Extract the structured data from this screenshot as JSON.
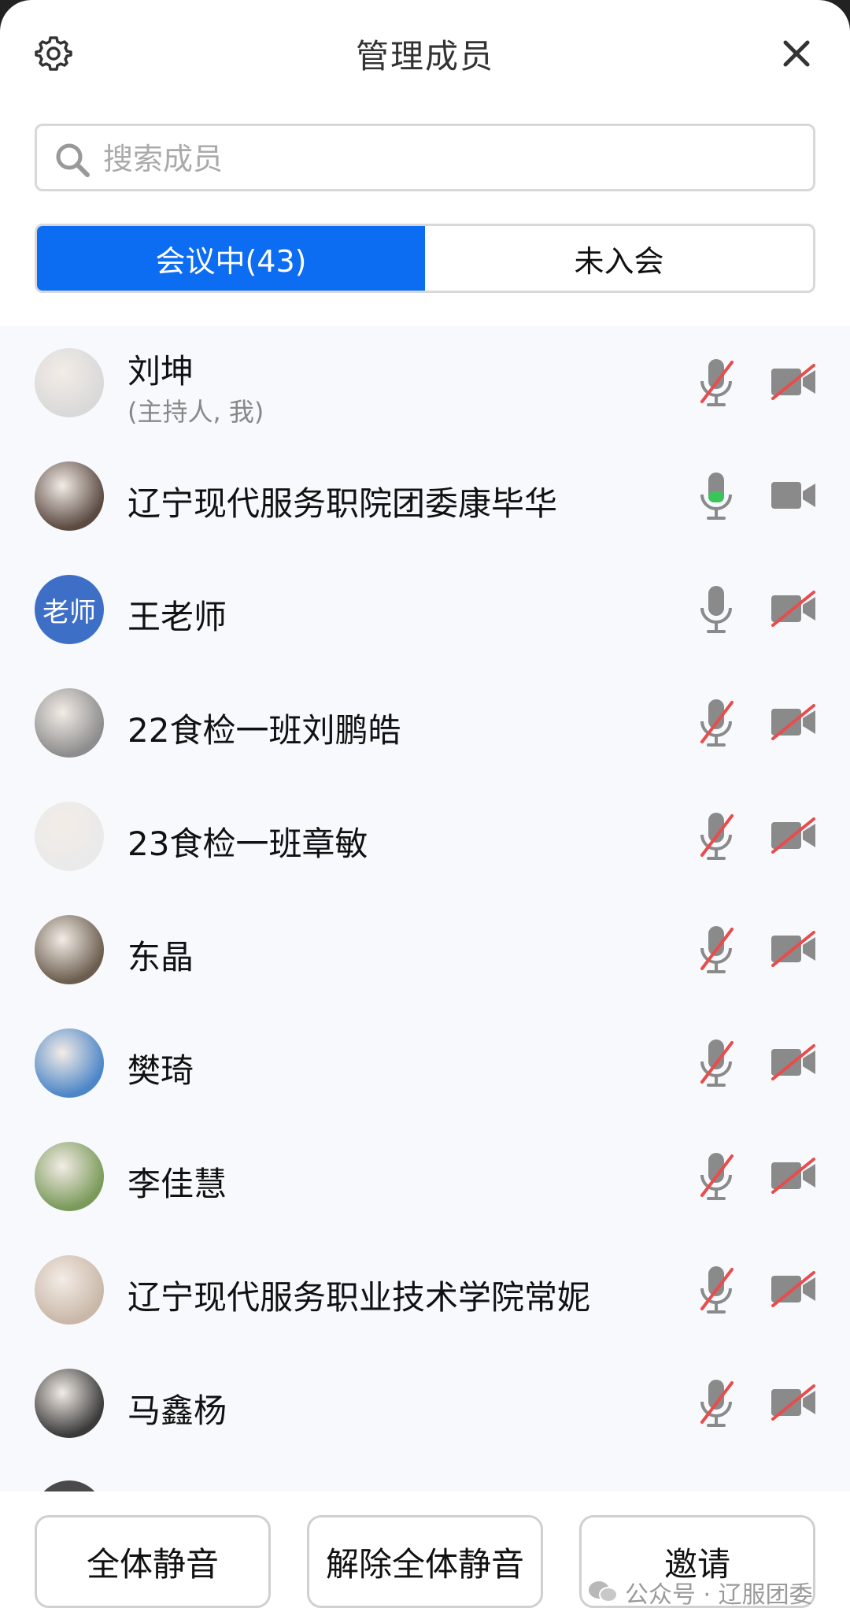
{
  "header": {
    "title": "管理成员"
  },
  "search": {
    "placeholder": "搜索成员"
  },
  "tabs": [
    {
      "label": "会议中(43)",
      "active": true
    },
    {
      "label": "未入会",
      "active": false
    }
  ],
  "members": [
    {
      "name": "刘坤",
      "role": "(主持人, 我)",
      "avatar": "avatar-image",
      "mic": "muted",
      "cam": "off"
    },
    {
      "name": "辽宁现代服务职院团委康毕华",
      "role": "",
      "avatar": "avatar-image",
      "mic": "speaking",
      "cam": "on"
    },
    {
      "name": "王老师",
      "role": "",
      "avatar_text": "老师",
      "mic": "on",
      "cam": "off"
    },
    {
      "name": "22食检一班刘鹏皓",
      "role": "",
      "avatar": "avatar-image",
      "mic": "muted",
      "cam": "off"
    },
    {
      "name": "23食检一班章敏",
      "role": "",
      "avatar": "avatar-image",
      "mic": "muted",
      "cam": "off"
    },
    {
      "name": "东晶",
      "role": "",
      "avatar": "avatar-image",
      "mic": "muted",
      "cam": "off"
    },
    {
      "name": "樊琦",
      "role": "",
      "avatar": "avatar-image",
      "mic": "muted",
      "cam": "off"
    },
    {
      "name": "李佳慧",
      "role": "",
      "avatar": "avatar-image",
      "mic": "muted",
      "cam": "off"
    },
    {
      "name": "辽宁现代服务职业技术学院常妮",
      "role": "",
      "avatar": "avatar-image",
      "mic": "muted",
      "cam": "off"
    },
    {
      "name": "马鑫杨",
      "role": "",
      "avatar": "avatar-image",
      "mic": "muted",
      "cam": "off"
    }
  ],
  "footer": {
    "mute_all": "全体静音",
    "unmute_all": "解除全体静音",
    "invite": "邀请"
  },
  "watermark": "公众号 · 辽服团委",
  "colors": {
    "accent": "#0c6cf2",
    "muted_red": "#e84c4c",
    "speaking_green": "#3ac45a",
    "icon_gray": "#8a8a8a"
  }
}
